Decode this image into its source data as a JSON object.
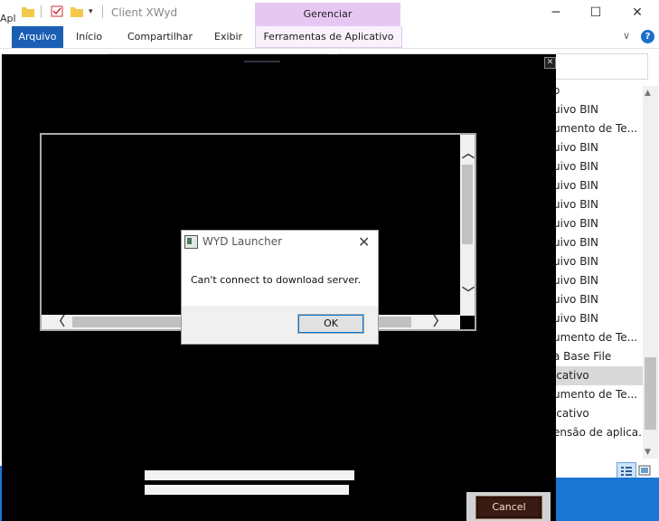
{
  "explorer": {
    "window_title": "Client XWyd",
    "contextual_group": "Gerenciar",
    "ribbon_tabs": [
      "Arquivo",
      "Início",
      "Compartilhar",
      "Exibir",
      "Ferramentas de Aplicativo"
    ],
    "help_label": "?",
    "left_label": "Apl",
    "file_rows": [
      {
        "name": "o",
        "selected": false
      },
      {
        "name": "uivo BIN",
        "selected": false
      },
      {
        "name": "umento de Te...",
        "selected": false
      },
      {
        "name": "uivo BIN",
        "selected": false
      },
      {
        "name": "uivo BIN",
        "selected": false
      },
      {
        "name": "uivo BIN",
        "selected": false
      },
      {
        "name": "uivo BIN",
        "selected": false
      },
      {
        "name": "uivo BIN",
        "selected": false
      },
      {
        "name": "uivo BIN",
        "selected": false
      },
      {
        "name": "uivo BIN",
        "selected": false
      },
      {
        "name": "uivo BIN",
        "selected": false
      },
      {
        "name": "uivo BIN",
        "selected": false
      },
      {
        "name": "uivo BIN",
        "selected": false
      },
      {
        "name": "umento de Te...",
        "selected": false
      },
      {
        "name": "a Base File",
        "selected": false
      },
      {
        "name": "icativo",
        "selected": true
      },
      {
        "name": "umento de Te...",
        "selected": false
      },
      {
        "name": "icativo",
        "selected": false
      },
      {
        "name": "ensão de aplica...",
        "selected": false
      }
    ],
    "icons": {
      "minimize": "─",
      "maximize": "☐",
      "close": "✕",
      "chevron": "∨"
    }
  },
  "launcher": {
    "cancel_label": "Cancel",
    "close_glyph": "✕",
    "scroll_up": "︿",
    "scroll_down": "﹀",
    "scroll_left": "〈",
    "scroll_right": "〉"
  },
  "dialog": {
    "title": "WYD Launcher",
    "message": "Can't connect to download server.",
    "ok_label": "OK",
    "close_glyph": "✕"
  },
  "colors": {
    "accent": "#1a5fb4",
    "contextual": "#e6c7f2",
    "launcher_bg": "#000000",
    "cancel_bg": "#3b1a14"
  }
}
